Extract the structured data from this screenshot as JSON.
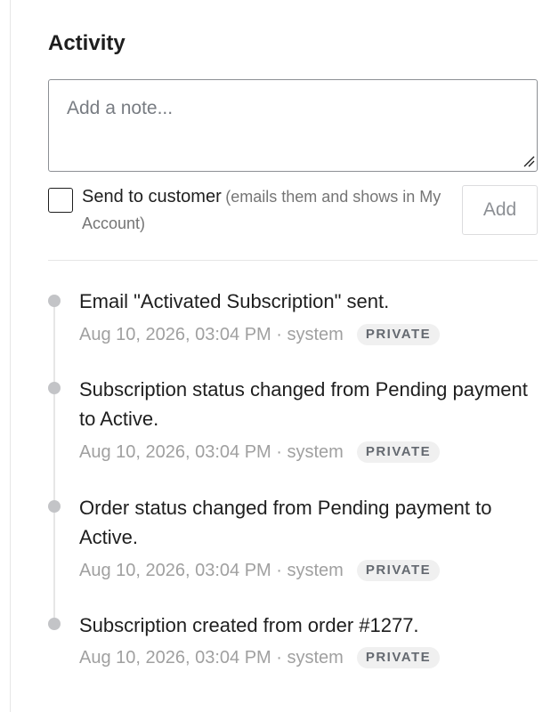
{
  "activity": {
    "title": "Activity",
    "note_placeholder": "Add a note...",
    "send_to_customer_label": "Send to customer",
    "send_to_customer_hint": "(emails them and shows in My Account)",
    "add_label": "Add",
    "entries": [
      {
        "text": "Email \"Activated Subscription\" sent.",
        "meta": "Aug 10, 2026, 03:04 PM · system",
        "badge": "PRIVATE"
      },
      {
        "text": "Subscription status changed from Pending payment to Active.",
        "meta": "Aug 10, 2026, 03:04 PM · system",
        "badge": "PRIVATE"
      },
      {
        "text": "Order status changed from Pending payment to Active.",
        "meta": "Aug 10, 2026, 03:04 PM · system",
        "badge": "PRIVATE"
      },
      {
        "text": "Subscription created from order #1277.",
        "meta": "Aug 10, 2026, 03:04 PM · system",
        "badge": "PRIVATE"
      }
    ]
  }
}
